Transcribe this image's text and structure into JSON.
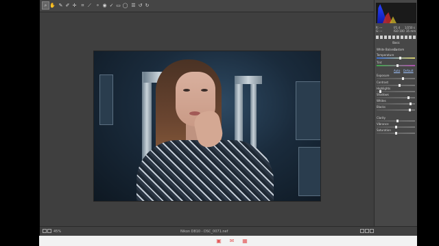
{
  "toolbar": {
    "tools": [
      "zoom-tool",
      "hand-tool",
      "white-balance-tool",
      "color-sampler-tool",
      "targeted-adjustment-tool",
      "crop-tool",
      "straighten-tool",
      "spot-removal-tool",
      "red-eye-tool",
      "adjustment-brush-tool",
      "graduated-filter-tool",
      "radial-filter-tool",
      "preferences",
      "rotate-left",
      "rotate-right"
    ],
    "active_tool": "zoom-tool"
  },
  "histogram": {
    "readout": {
      "r_label": "R:",
      "r_value": "---",
      "g_label": "G:",
      "g_value": "---",
      "b_label": "B:",
      "b_value": "---",
      "aperture": "f/1.4",
      "shutter": "1/250 s",
      "iso": "ISO 100",
      "focal": "35 mm"
    }
  },
  "panel": {
    "section_title": "Basic",
    "white_balance": {
      "label": "White Balance:",
      "value": "Custom"
    },
    "auto_link": "Auto",
    "default_link": "Default",
    "sliders": [
      {
        "label": "Temperature",
        "value": "",
        "level": 0.62
      },
      {
        "label": "Tint",
        "value": "",
        "level": 0.54
      },
      {
        "label": "Exposure",
        "value": "",
        "level": 0.7
      },
      {
        "label": "Contrast",
        "value": "",
        "level": 0.6
      },
      {
        "label": "Highlights",
        "value": "",
        "level": 0.08
      },
      {
        "label": "Shadows",
        "value": "",
        "level": 0.84
      },
      {
        "label": "Whites",
        "value": "",
        "level": 0.9
      },
      {
        "label": "Blacks",
        "value": "",
        "level": 0.88
      },
      {
        "label": "Clarity",
        "value": "",
        "level": 0.55
      },
      {
        "label": "Vibrance",
        "value": "",
        "level": 0.5
      },
      {
        "label": "Saturation",
        "value": "",
        "level": 0.5
      }
    ]
  },
  "statusbar": {
    "zoom": "45%",
    "filename": "Nikon D810 - DSC_0071.nef"
  },
  "bottom_bar": {
    "icons": [
      "app-icon-1",
      "app-icon-2",
      "app-icon-3"
    ]
  }
}
